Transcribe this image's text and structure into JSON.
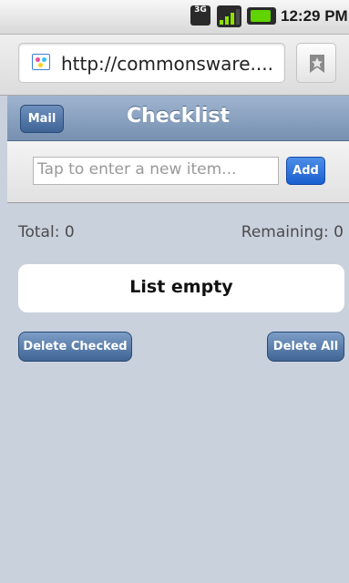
{
  "status_bar": {
    "network": "3G",
    "time": "12:29 PM"
  },
  "browser": {
    "url": "http://commonsware....",
    "favicon": "site-favicon",
    "bookmark_icon": "star-bookmark-icon"
  },
  "header": {
    "mail_label": "Mail",
    "title": "Checklist"
  },
  "new_item": {
    "placeholder": "Tap to enter a new item...",
    "value": "",
    "add_label": "Add"
  },
  "counts": {
    "total": "Total: 0",
    "remaining": "Remaining: 0"
  },
  "list": {
    "empty_text": "List empty"
  },
  "actions": {
    "delete_checked_label": "Delete Checked",
    "delete_all_label": "Delete All"
  },
  "colors": {
    "header": "#7d96b6",
    "add_button": "#2a6cd8",
    "background": "#c9d1dd"
  }
}
